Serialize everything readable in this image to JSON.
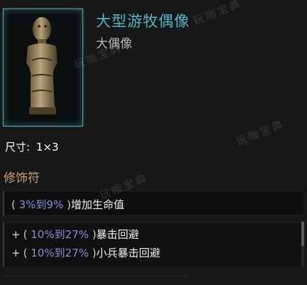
{
  "item": {
    "name": "大型游牧偶像",
    "type": "大偶像",
    "icon": "idol-statue-icon",
    "accent_color": "#4fb6c4"
  },
  "size": {
    "label": "尺寸:",
    "value": "1×3"
  },
  "modifiers": {
    "title": "修饰符",
    "implicit": [
      {
        "range_open": "(",
        "range": "3%到9%",
        "range_close": ")",
        "text": "增加生命值"
      }
    ],
    "explicit": [
      {
        "prefix": "+",
        "range_open": "(",
        "range": "10%到27%",
        "range_close": ")",
        "text": "暴击回避"
      },
      {
        "prefix": "+",
        "range_open": "(",
        "range": "10%到27%",
        "range_close": ")",
        "text": "小兵暴击回避"
      }
    ]
  },
  "watermark": {
    "text": "玩咖宝典"
  }
}
